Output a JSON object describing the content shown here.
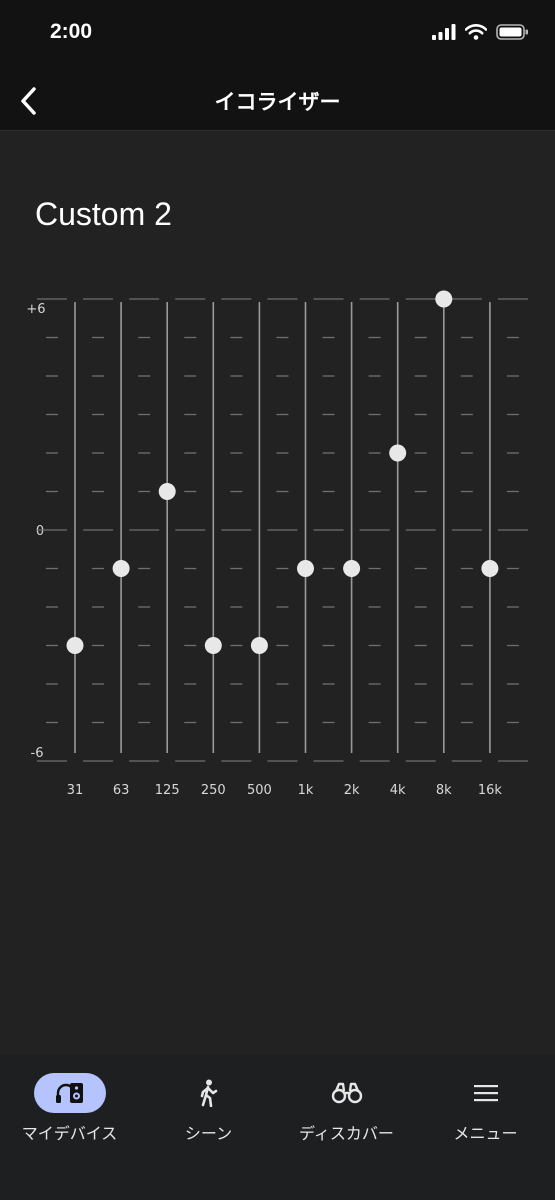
{
  "status_bar": {
    "time": "2:00"
  },
  "nav": {
    "title": "イコライザー",
    "back_icon": "chevron-left-icon"
  },
  "preset_name": "Custom 2",
  "equalizer": {
    "y_axis_labels": {
      "max": "+6",
      "zero": "0",
      "min": "-6"
    },
    "range": [
      -6,
      6
    ],
    "bands": [
      {
        "label": "31",
        "value": -3
      },
      {
        "label": "63",
        "value": -1
      },
      {
        "label": "125",
        "value": 1
      },
      {
        "label": "250",
        "value": -3
      },
      {
        "label": "500",
        "value": -3
      },
      {
        "label": "1k",
        "value": -1
      },
      {
        "label": "2k",
        "value": -1
      },
      {
        "label": "4k",
        "value": 2
      },
      {
        "label": "8k",
        "value": 6
      },
      {
        "label": "16k",
        "value": -1
      }
    ]
  },
  "bottom_nav": {
    "items": [
      {
        "label": "マイデバイス",
        "icon": "headphones-speaker-icon",
        "active": true
      },
      {
        "label": "シーン",
        "icon": "walking-person-icon",
        "active": false
      },
      {
        "label": "ディスカバー",
        "icon": "binoculars-icon",
        "active": false
      },
      {
        "label": "メニュー",
        "icon": "menu-icon",
        "active": false
      }
    ]
  },
  "colors": {
    "background": "#222222",
    "bar": "#121212",
    "accent": "#b5c3ff",
    "knob": "#e8e8e8"
  }
}
